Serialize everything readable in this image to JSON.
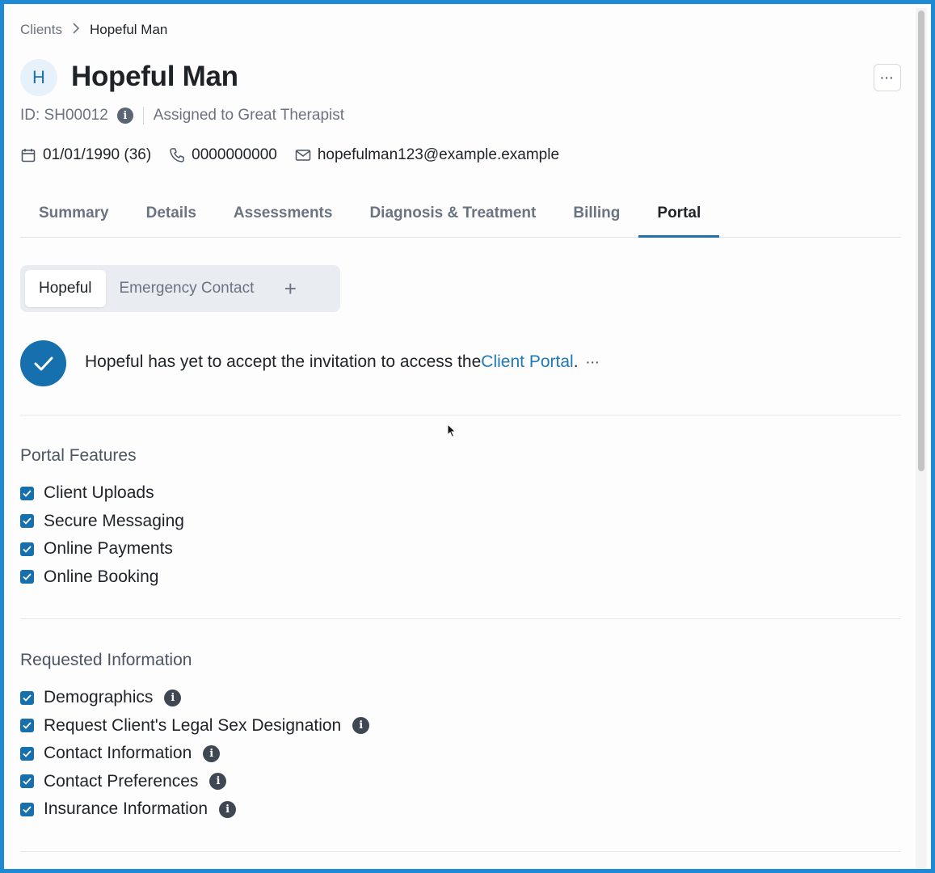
{
  "breadcrumb": {
    "parent": "Clients",
    "current": "Hopeful Man"
  },
  "client": {
    "avatar_initial": "H",
    "name": "Hopeful Man",
    "id_text": "ID: SH00012",
    "assigned": "Assigned to Great Therapist",
    "dob": "01/01/1990 (36)",
    "phone": "0000000000",
    "email": "hopefulman123@example.example"
  },
  "more_button_label": "···",
  "tabs": [
    {
      "label": "Summary",
      "active": false
    },
    {
      "label": "Details",
      "active": false
    },
    {
      "label": "Assessments",
      "active": false
    },
    {
      "label": "Diagnosis & Treatment",
      "active": false
    },
    {
      "label": "Billing",
      "active": false
    },
    {
      "label": "Portal",
      "active": true
    }
  ],
  "segment": {
    "items": [
      {
        "label": "Hopeful",
        "active": true
      },
      {
        "label": "Emergency Contact",
        "active": false
      }
    ],
    "add_label": "+"
  },
  "invitation": {
    "text": "Hopeful has yet to accept the invitation to access the ",
    "link": "Client Portal",
    "suffix": ".",
    "more": "···"
  },
  "portal_features": {
    "title": "Portal Features",
    "items": [
      {
        "label": "Client Uploads",
        "checked": true
      },
      {
        "label": "Secure Messaging",
        "checked": true
      },
      {
        "label": "Online Payments",
        "checked": true
      },
      {
        "label": "Online Booking",
        "checked": true
      }
    ]
  },
  "requested_information": {
    "title": "Requested Information",
    "items": [
      {
        "label": "Demographics",
        "checked": true,
        "info": true
      },
      {
        "label": "Request Client's Legal Sex Designation",
        "checked": true,
        "info": true
      },
      {
        "label": "Contact Information",
        "checked": true,
        "info": true
      },
      {
        "label": "Contact Preferences",
        "checked": true,
        "info": true
      },
      {
        "label": "Insurance Information",
        "checked": true,
        "info": true
      }
    ]
  },
  "colors": {
    "accent": "#1670ad",
    "frame": "#1e8ad3",
    "link": "#1f78b8"
  },
  "icons": {
    "info": "info-icon",
    "calendar": "calendar-icon",
    "phone": "phone-icon",
    "mail": "mail-icon",
    "check": "check-icon",
    "plus": "plus-icon",
    "chevron": "chevron-right-icon",
    "more": "more-horizontal-icon"
  }
}
